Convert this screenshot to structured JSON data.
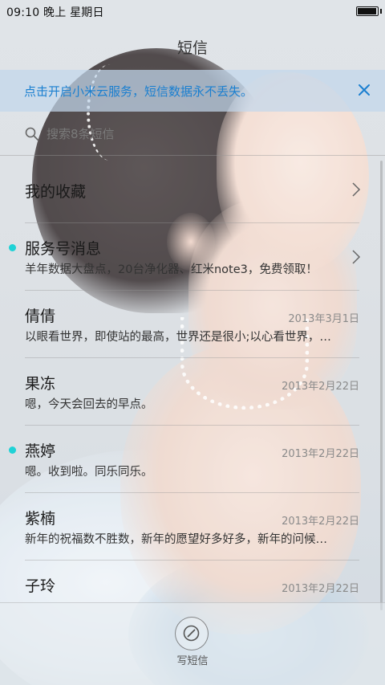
{
  "status_bar": {
    "time": "09:10",
    "period": "晚上",
    "weekday": "星期日",
    "battery_level": 0.95
  },
  "app": {
    "title": "短信"
  },
  "banner": {
    "text": "点击开启小米云服务，短信数据永不丢失。",
    "close_icon": "close-icon",
    "color": "#1a7fd0"
  },
  "search": {
    "placeholder": "搜索8条短信",
    "icon": "search-icon"
  },
  "conversations": [
    {
      "name": "我的收藏",
      "preview": "",
      "date": "",
      "unread": false,
      "chevron": true
    },
    {
      "name": "服务号消息",
      "preview": "羊年数据大盘点，20台净化器、红米note3，免费领取！",
      "date": "",
      "unread": true,
      "chevron": true
    },
    {
      "name": "倩倩",
      "preview": "以眼看世界，即使站的最高，世界还是很小;以心看世界，…",
      "date": "2013年3月1日",
      "unread": false,
      "chevron": false
    },
    {
      "name": "果冻",
      "preview": "嗯，今天会回去的早点。",
      "date": "2013年2月22日",
      "unread": false,
      "chevron": false
    },
    {
      "name": "燕婷",
      "preview": "嗯。收到啦。同乐同乐。",
      "date": "2013年2月22日",
      "unread": true,
      "chevron": false
    },
    {
      "name": "紫楠",
      "preview": "新年的祝福数不胜数，新年的愿望好多好多，新年的问候…",
      "date": "2013年2月22日",
      "unread": false,
      "chevron": false
    },
    {
      "name": "子玲",
      "preview": "",
      "date": "2013年2月22日",
      "unread": false,
      "chevron": false
    }
  ],
  "compose": {
    "label": "写短信",
    "icon": "compose-icon"
  },
  "colors": {
    "unread_dot": "#1fd2d6",
    "accent": "#1a7fd0"
  }
}
